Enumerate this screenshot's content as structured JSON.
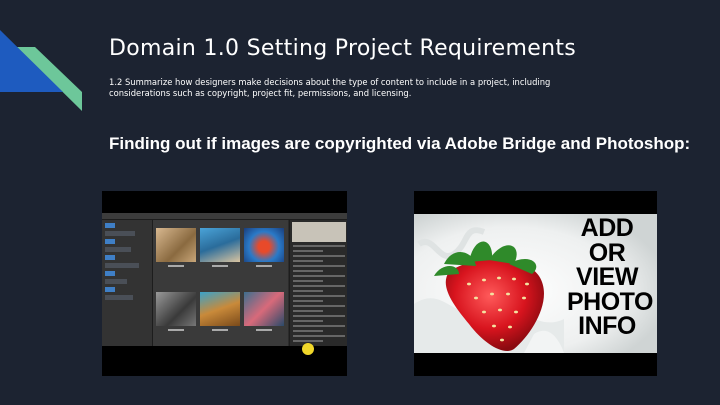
{
  "slide": {
    "title": "Domain 1.0 Setting Project Requirements",
    "subtitle": "1.2 Summarize how designers make decisions about the type of content to include in a project, including considerations such as copyright, project fit, permissions, and licensing.",
    "heading": "Finding out if images are copyrighted via Adobe Bridge and Photoshop:"
  },
  "videos": {
    "right": {
      "text_lines": [
        "ADD",
        "OR",
        "VIEW",
        "PHOTO",
        "INFO"
      ]
    }
  },
  "colors": {
    "background": "#1c2331",
    "accent_blue": "#1e5bbf",
    "accent_green": "#6dc79a",
    "cursor": "#f0d72a"
  }
}
